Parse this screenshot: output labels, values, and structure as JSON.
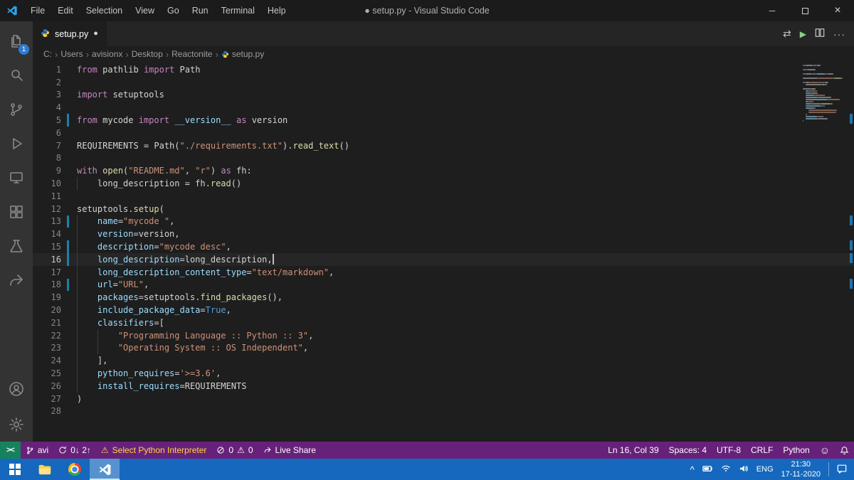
{
  "colors": {
    "status_bar": "#68217a",
    "taskbar": "#1568bd",
    "activity_bar": "#333333",
    "editor_background": "#1e1e1e",
    "keyword": "#c586c0",
    "string": "#ce9178",
    "function": "#dcdcaa",
    "parameter": "#9cdcfe",
    "constant": "#569cd6",
    "text": "#d4d4d4",
    "modified_gutter": "#1b81a8",
    "badge": "#2e7bd6",
    "remote_indicator": "#16825d",
    "warning_text": "#ffd740",
    "run_button": "#89d185"
  },
  "titlebar": {
    "title": "● setup.py - Visual Studio Code",
    "menus": [
      "File",
      "Edit",
      "Selection",
      "View",
      "Go",
      "Run",
      "Terminal",
      "Help"
    ]
  },
  "activity_bar": {
    "explorer_badge": "1"
  },
  "tab_bar": {
    "tab_label": "setup.py"
  },
  "breadcrumb": {
    "items": [
      "C:",
      "Users",
      "avisionx",
      "Desktop",
      "Reactonite",
      "setup.py"
    ]
  },
  "editor": {
    "cursor_position": {
      "line": 16,
      "col": 39
    },
    "lines": [
      {
        "n": 1,
        "tokens": [
          [
            "kw",
            "from"
          ],
          [
            "pl",
            " pathlib "
          ],
          [
            "kw",
            "import"
          ],
          [
            "pl",
            " Path"
          ]
        ]
      },
      {
        "n": 2,
        "tokens": []
      },
      {
        "n": 3,
        "tokens": [
          [
            "kw",
            "import"
          ],
          [
            "pl",
            " setuptools"
          ]
        ]
      },
      {
        "n": 4,
        "tokens": []
      },
      {
        "n": 5,
        "mod": true,
        "tokens": [
          [
            "kw",
            "from"
          ],
          [
            "pl",
            " mycode "
          ],
          [
            "kw",
            "import"
          ],
          [
            "pl",
            " "
          ],
          [
            "param",
            "__version__"
          ],
          [
            "pl",
            " "
          ],
          [
            "kw",
            "as"
          ],
          [
            "pl",
            " version"
          ]
        ]
      },
      {
        "n": 6,
        "tokens": []
      },
      {
        "n": 7,
        "tokens": [
          [
            "pl",
            "REQUIREMENTS = Path("
          ],
          [
            "str",
            "\"./requirements.txt\""
          ],
          [
            "pl",
            ")."
          ],
          [
            "fn",
            "read_text"
          ],
          [
            "pl",
            "()"
          ]
        ]
      },
      {
        "n": 8,
        "tokens": []
      },
      {
        "n": 9,
        "tokens": [
          [
            "kw",
            "with"
          ],
          [
            "pl",
            " "
          ],
          [
            "fn",
            "open"
          ],
          [
            "pl",
            "("
          ],
          [
            "str",
            "\"README.md\""
          ],
          [
            "pl",
            ", "
          ],
          [
            "str",
            "\"r\""
          ],
          [
            "pl",
            ") "
          ],
          [
            "kw",
            "as"
          ],
          [
            "pl",
            " fh:"
          ]
        ]
      },
      {
        "n": 10,
        "tokens": [
          [
            "ws",
            "    "
          ],
          [
            "pl",
            "long_description = fh."
          ],
          [
            "fn",
            "read"
          ],
          [
            "pl",
            "()"
          ]
        ]
      },
      {
        "n": 11,
        "tokens": []
      },
      {
        "n": 12,
        "tokens": [
          [
            "pl",
            "setuptools."
          ],
          [
            "fn",
            "setup"
          ],
          [
            "pl",
            "("
          ]
        ]
      },
      {
        "n": 13,
        "mod": true,
        "tokens": [
          [
            "ws",
            "    "
          ],
          [
            "param",
            "name"
          ],
          [
            "pl",
            "="
          ],
          [
            "str",
            "\"mycode \""
          ],
          [
            "pl",
            ","
          ]
        ]
      },
      {
        "n": 14,
        "tokens": [
          [
            "ws",
            "    "
          ],
          [
            "param",
            "version"
          ],
          [
            "pl",
            "=version,"
          ]
        ]
      },
      {
        "n": 15,
        "mod": true,
        "tokens": [
          [
            "ws",
            "    "
          ],
          [
            "param",
            "description"
          ],
          [
            "pl",
            "="
          ],
          [
            "str",
            "\"mycode desc\""
          ],
          [
            "pl",
            ","
          ]
        ]
      },
      {
        "n": 16,
        "mod": true,
        "current": true,
        "cursor": true,
        "tokens": [
          [
            "ws",
            "    "
          ],
          [
            "param",
            "long_description"
          ],
          [
            "pl",
            "=long_description,"
          ]
        ]
      },
      {
        "n": 17,
        "tokens": [
          [
            "ws",
            "    "
          ],
          [
            "param",
            "long_description_content_type"
          ],
          [
            "pl",
            "="
          ],
          [
            "str",
            "\"text/markdown\""
          ],
          [
            "pl",
            ","
          ]
        ]
      },
      {
        "n": 18,
        "mod": true,
        "tokens": [
          [
            "ws",
            "    "
          ],
          [
            "param",
            "url"
          ],
          [
            "pl",
            "="
          ],
          [
            "str",
            "\"URL\""
          ],
          [
            "pl",
            ","
          ]
        ]
      },
      {
        "n": 19,
        "tokens": [
          [
            "ws",
            "    "
          ],
          [
            "param",
            "packages"
          ],
          [
            "pl",
            "=setuptools."
          ],
          [
            "fn",
            "find_packages"
          ],
          [
            "pl",
            "(),"
          ]
        ]
      },
      {
        "n": 20,
        "tokens": [
          [
            "ws",
            "    "
          ],
          [
            "param",
            "include_package_data"
          ],
          [
            "pl",
            "="
          ],
          [
            "const",
            "True"
          ],
          [
            "pl",
            ","
          ]
        ]
      },
      {
        "n": 21,
        "tokens": [
          [
            "ws",
            "    "
          ],
          [
            "param",
            "classifiers"
          ],
          [
            "pl",
            "=["
          ]
        ]
      },
      {
        "n": 22,
        "tokens": [
          [
            "ws",
            "    "
          ],
          [
            "ws",
            "    "
          ],
          [
            "str",
            "\"Programming Language :: Python :: 3\""
          ],
          [
            "pl",
            ","
          ]
        ]
      },
      {
        "n": 23,
        "tokens": [
          [
            "ws",
            "    "
          ],
          [
            "ws",
            "    "
          ],
          [
            "str",
            "\"Operating System :: OS Independent\""
          ],
          [
            "pl",
            ","
          ]
        ]
      },
      {
        "n": 24,
        "tokens": [
          [
            "ws",
            "    "
          ],
          [
            "pl",
            "],"
          ]
        ]
      },
      {
        "n": 25,
        "tokens": [
          [
            "ws",
            "    "
          ],
          [
            "param",
            "python_requires"
          ],
          [
            "pl",
            "="
          ],
          [
            "str",
            "'>=3.6'"
          ],
          [
            "pl",
            ","
          ]
        ]
      },
      {
        "n": 26,
        "tokens": [
          [
            "ws",
            "    "
          ],
          [
            "param",
            "install_requires"
          ],
          [
            "pl",
            "=REQUIREMENTS"
          ]
        ]
      },
      {
        "n": 27,
        "tokens": [
          [
            "pl",
            ")"
          ]
        ]
      },
      {
        "n": 28,
        "tokens": []
      }
    ]
  },
  "status_bar": {
    "remote_label": "><",
    "branch": "avi",
    "sync": "0↓ 2↑",
    "interpreter_warning": "Select Python Interpreter",
    "error_count": "0",
    "warning_count": "0",
    "live_share": "Live Share",
    "cursor": "Ln 16, Col 39",
    "indent": "Spaces: 4",
    "encoding": "UTF-8",
    "eol": "CRLF",
    "language": "Python"
  },
  "taskbar": {
    "tray_language": "ENG",
    "time": "21:30",
    "date": "17-11-2020"
  },
  "icons": {
    "modified_dot": "●",
    "breadcrumb_sep": "›",
    "open_changes": "⇄",
    "run": "▶",
    "more": "···",
    "minimize": "─",
    "close": "×",
    "warning": "⚠",
    "smiley": "☺",
    "chevron_up": "^"
  }
}
